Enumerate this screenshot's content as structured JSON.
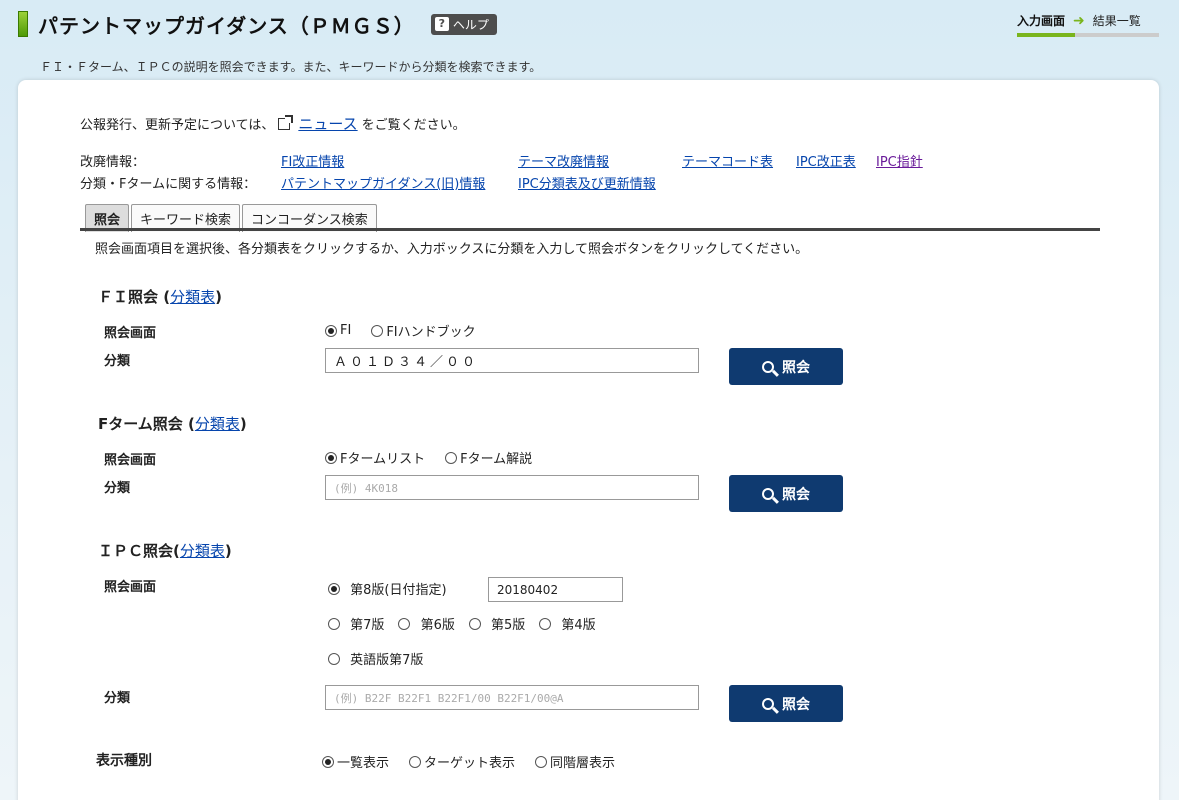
{
  "header": {
    "title": "パテントマップガイダンス（ＰＭＧＳ）",
    "help_label": "ヘルプ",
    "help_glyph": "?",
    "subtitle": "ＦＩ・Ｆターム、ＩＰＣの説明を照会できます。また、キーワードから分類を検索できます。"
  },
  "steps": {
    "current": "入力画面",
    "arrow": "➜",
    "next": "結果一覧"
  },
  "notice": {
    "before": "公報発行、更新予定については、",
    "link": "ニュース",
    "after": "をご覧ください。"
  },
  "info": {
    "row1_label": "改廃情報：",
    "row1_links": [
      "FI改正情報",
      "テーマ改廃情報",
      "テーマコード表",
      "IPC改正表",
      "IPC指針"
    ],
    "row2_label": "分類・Fタームに関する情報：",
    "row2_links": [
      "パテントマップガイダンス(旧)情報",
      "IPC分類表及び更新情報"
    ]
  },
  "tabs": [
    "照会",
    "キーワード検索",
    "コンコーダンス検索"
  ],
  "instructions": "照会画面項目を選択後、各分類表をクリックするか、入力ボックスに分類を入力して照会ボタンをクリックしてください。",
  "fi": {
    "title": "ＦＩ照会",
    "table_link": "分類表",
    "screen_label": "照会画面",
    "options": [
      "FI",
      "FIハンドブック"
    ],
    "class_label": "分類",
    "value": "Ａ０１Ｄ３４／００",
    "button": "照会"
  },
  "fterm": {
    "title": "Fターム照会",
    "table_link": "分類表",
    "screen_label": "照会画面",
    "options": [
      "Fタームリスト",
      "Fターム解説"
    ],
    "class_label": "分類",
    "placeholder": "(例) 4K018",
    "button": "照会"
  },
  "ipc": {
    "title": "ＩＰＣ照会",
    "table_link": "分類表",
    "screen_label": "照会画面",
    "option_8": "第8版(日付指定)",
    "date_value": "20180402",
    "options_old": [
      "第7版",
      "第6版",
      "第5版",
      "第4版"
    ],
    "option_en": "英語版第7版",
    "class_label": "分類",
    "placeholder": "(例) B22F B22F1 B22F1/00 B22F1/00@A",
    "button": "照会"
  },
  "display": {
    "label": "表示種別",
    "options": [
      "一覧表示",
      "ターゲット表示",
      "同階層表示"
    ]
  },
  "colors": {
    "accent_green": "#7ab51d",
    "button_navy": "#0f3a70",
    "link_blue": "#0645ad"
  }
}
